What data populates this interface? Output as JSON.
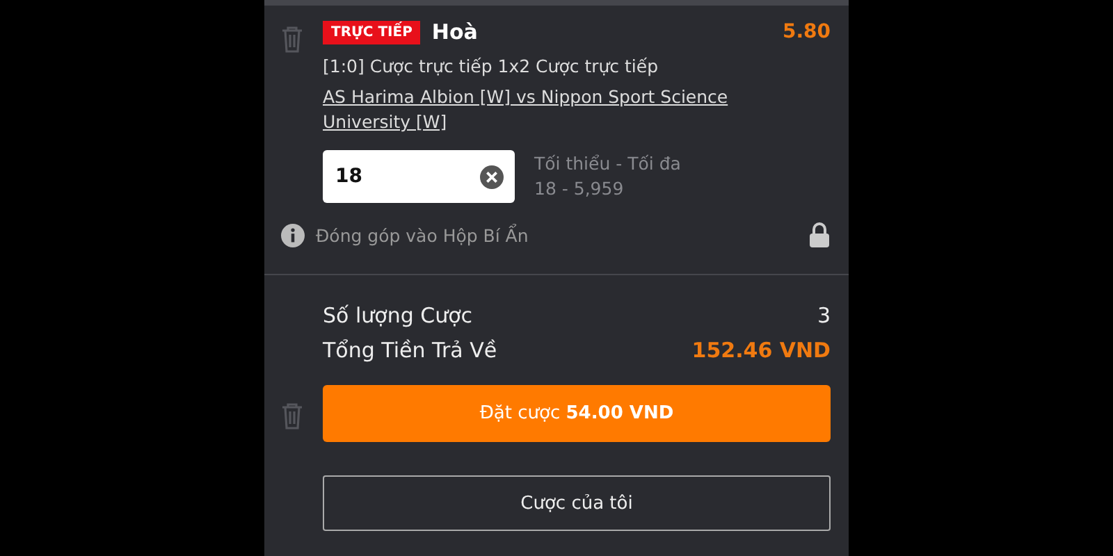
{
  "bet": {
    "live_badge": "TRỰC TIẾP",
    "selection": "Hoà",
    "odds": "5.80",
    "market": "[1:0] Cược trực tiếp 1x2 Cược trực tiếp",
    "match_link": "AS Harima Albion [W] vs Nippon Sport Science University [W]",
    "stake": "18",
    "limits_label": "Tối thiểu - Tối đa",
    "limits": "18 - 5,959",
    "mystery_note": "Đóng góp vào Hộp Bí Ẩn",
    "locked": true
  },
  "summary": [
    {
      "label": "Số lượng Cược",
      "value": "3",
      "kind": "plain"
    },
    {
      "label": "Tổng Tiền Trả Về",
      "value": "152.46 VND",
      "kind": "highlight"
    }
  ],
  "place_button": "Đặt cược **54.00 VND**",
  "my_bets_button": "Cược của tôi"
}
